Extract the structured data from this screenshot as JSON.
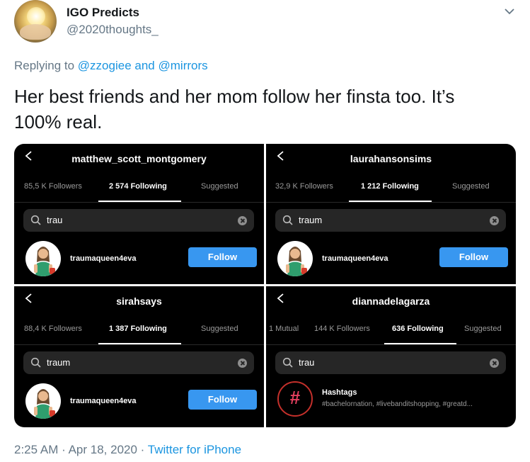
{
  "tweet": {
    "display_name": "IGO Predicts",
    "handle": "@2020thoughts_",
    "reply_prefix": "Replying to",
    "reply_mention_1": "@zzogiee",
    "reply_and": "and",
    "reply_mention_2": "@mirrors",
    "text_line_1": "Her best friends and her mom follow her finsta too. It’s",
    "text_line_2": "100% real.",
    "time": "2:25 AM",
    "dot_1": "·",
    "date": "Apr 18, 2020",
    "dot_2": "·",
    "source": "Twitter for iPhone"
  },
  "panels": [
    {
      "title": "matthew_scott_montgomery",
      "tabs": [
        "85,5 K Followers",
        "2 574 Following",
        "Suggested"
      ],
      "active_tab": "2 574 Following",
      "search_text": "trau",
      "result_name": "traumaqueen4eva",
      "button_label": "Follow"
    },
    {
      "title": "laurahansonsims",
      "tabs": [
        "32,9 K Followers",
        "1 212 Following",
        "Suggested"
      ],
      "active_tab": "1 212 Following",
      "search_text": "traum",
      "result_name": "traumaqueen4eva",
      "button_label": "Follow"
    },
    {
      "title": "sirahsays",
      "tabs": [
        "88,4 K Followers",
        "1 387 Following",
        "Suggested"
      ],
      "active_tab": "1 387 Following",
      "search_text": "traum",
      "result_name": "traumaqueen4eva",
      "button_label": "Follow"
    },
    {
      "title": "diannadelagarza",
      "tabs": [
        "1 Mutual",
        "144 K Followers",
        "636 Following",
        "Suggested"
      ],
      "active_tab": "636 Following",
      "search_text": "trau",
      "hashtag_symbol": "#",
      "hashtag_title": "Hashtags",
      "hashtag_sub": "#bachelornation, #livebanditshopping, #greatd..."
    }
  ],
  "colors": {
    "link": "#1b95e0",
    "follow_button": "#3897f0",
    "panel_bg": "#000000",
    "search_bg": "#262626"
  },
  "icons": [
    "chevron-down-icon",
    "back-arrow-icon",
    "search-icon",
    "clear-search-icon"
  ]
}
